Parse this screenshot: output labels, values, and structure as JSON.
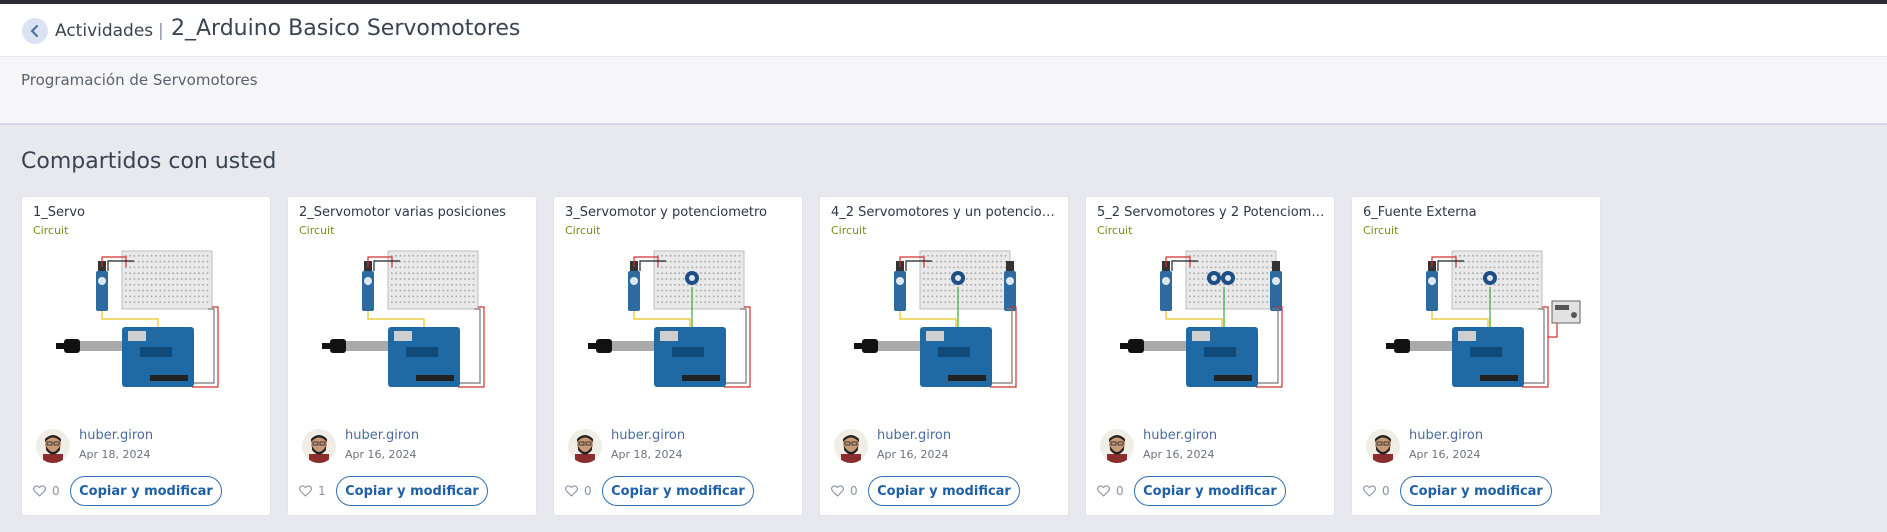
{
  "header": {
    "breadcrumb": "Actividades",
    "title": "2_Arduino Basico Servomotores",
    "back_icon": "chevron-left-icon"
  },
  "description": "Programación de Servomotores",
  "section_title": "Compartidos con usted",
  "colors": {
    "accent": "#2f6fb5",
    "circuit_label": "#7a8a1a",
    "page_bg": "#e8e9ee"
  },
  "cards": [
    {
      "title": "1_Servo",
      "type": "Circuit",
      "author": "huber.giron",
      "date": "Apr 18, 2024",
      "likes": "0",
      "button": "Copiar y modificar",
      "pots": 0,
      "servos": 1,
      "external": false
    },
    {
      "title": "2_Servomotor varias posiciones",
      "type": "Circuit",
      "author": "huber.giron",
      "date": "Apr 16, 2024",
      "likes": "1",
      "button": "Copiar y modificar",
      "pots": 0,
      "servos": 1,
      "external": false
    },
    {
      "title": "3_Servomotor y potenciometro",
      "type": "Circuit",
      "author": "huber.giron",
      "date": "Apr 18, 2024",
      "likes": "0",
      "button": "Copiar y modificar",
      "pots": 1,
      "servos": 1,
      "external": false
    },
    {
      "title": "4_2 Servomotores y un potenciome...",
      "type": "Circuit",
      "author": "huber.giron",
      "date": "Apr 16, 2024",
      "likes": "0",
      "button": "Copiar y modificar",
      "pots": 1,
      "servos": 2,
      "external": false
    },
    {
      "title": "5_2 Servomotores y 2 Potenciometr...",
      "type": "Circuit",
      "author": "huber.giron",
      "date": "Apr 16, 2024",
      "likes": "0",
      "button": "Copiar y modificar",
      "pots": 2,
      "servos": 2,
      "external": false
    },
    {
      "title": "6_Fuente Externa",
      "type": "Circuit",
      "author": "huber.giron",
      "date": "Apr 16, 2024",
      "likes": "0",
      "button": "Copiar y modificar",
      "pots": 1,
      "servos": 1,
      "external": true
    }
  ]
}
